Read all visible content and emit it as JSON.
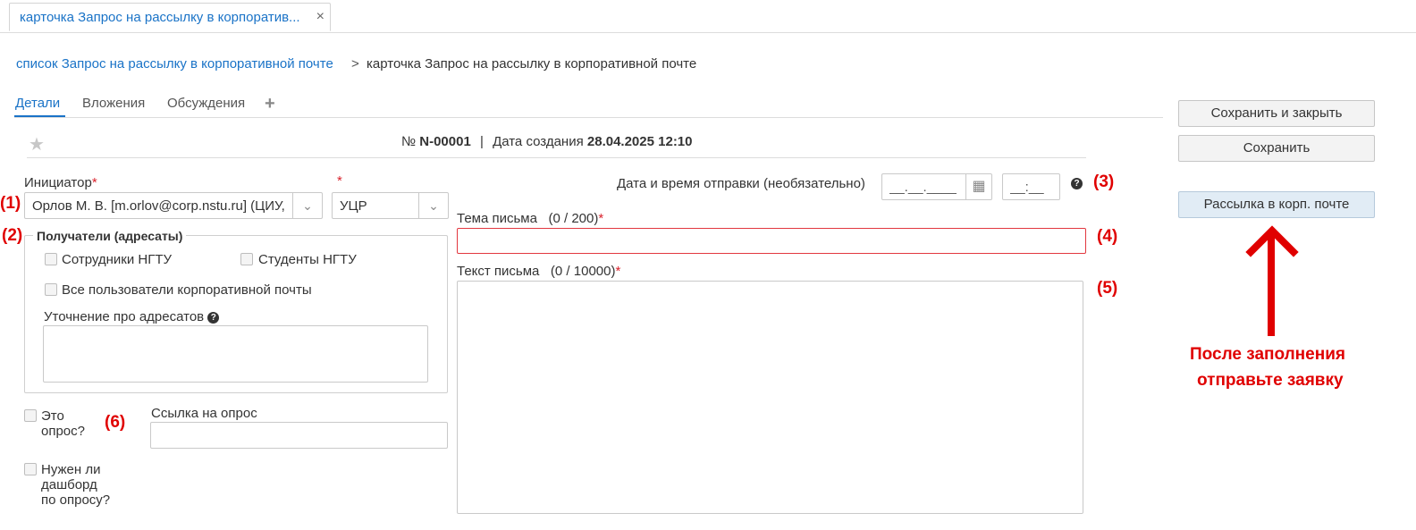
{
  "window_tab": {
    "title": "карточка Запрос на рассылку в корпоратив...",
    "close": "×"
  },
  "breadcrumb": {
    "link": "список Запрос на рассылку в корпоративной почте",
    "separator": ">",
    "current": "карточка Запрос на рассылку в корпоративной почте"
  },
  "tabs": [
    {
      "label": "Детали",
      "active": true
    },
    {
      "label": "Вложения",
      "active": false
    },
    {
      "label": "Обсуждения",
      "active": false
    }
  ],
  "tabs_add": "+",
  "buttons": {
    "save_close": "Сохранить и закрыть",
    "save": "Сохранить",
    "mailing": "Рассылка в корп. почте"
  },
  "header": {
    "number_label": "№",
    "number": "N-00001",
    "sep": "|",
    "created_label": "Дата создания",
    "created": "28.04.2025 12:10"
  },
  "form": {
    "initiator_label": "Инициатор",
    "required_mark": "*",
    "initiator_value": "Орлов М. В. [m.orlov@corp.nstu.ru] (ЦИУ,",
    "dept_value": "УЦР",
    "send_datetime_label": "Дата и время отправки (необязательно)",
    "date_placeholder": "__.__.____",
    "time_placeholder": "__:__",
    "recipients_legend": "Получатели (адресаты)",
    "cb_employees": "Сотрудники НГТУ",
    "cb_students": "Студенты НГТУ",
    "cb_all_users": "Все пользователи корпоративной почты",
    "clarify_label": "Уточнение про адресатов",
    "subject_label": "Тема письма",
    "subject_counter": "(0 / 200)",
    "body_label": "Текст письма",
    "body_counter": "(0 / 10000)",
    "cb_survey_line1": "Это",
    "cb_survey_line2": "опрос?",
    "survey_link_label": "Ссылка на опрос",
    "cb_dashboard_line1": "Нужен ли",
    "cb_dashboard_line2": "дашборд",
    "cb_dashboard_line3": "по опросу?"
  },
  "annotations": {
    "n1": "(1)",
    "n2": "(2)",
    "n3": "(3)",
    "n4": "(4)",
    "n5": "(5)",
    "n6": "(6)",
    "note_line1": "После заполнения",
    "note_line2": "отправьте заявку",
    "color": "#e00000"
  },
  "icons": {
    "star": "★",
    "chevron": "⌄",
    "calendar": "▦",
    "help": "?"
  }
}
